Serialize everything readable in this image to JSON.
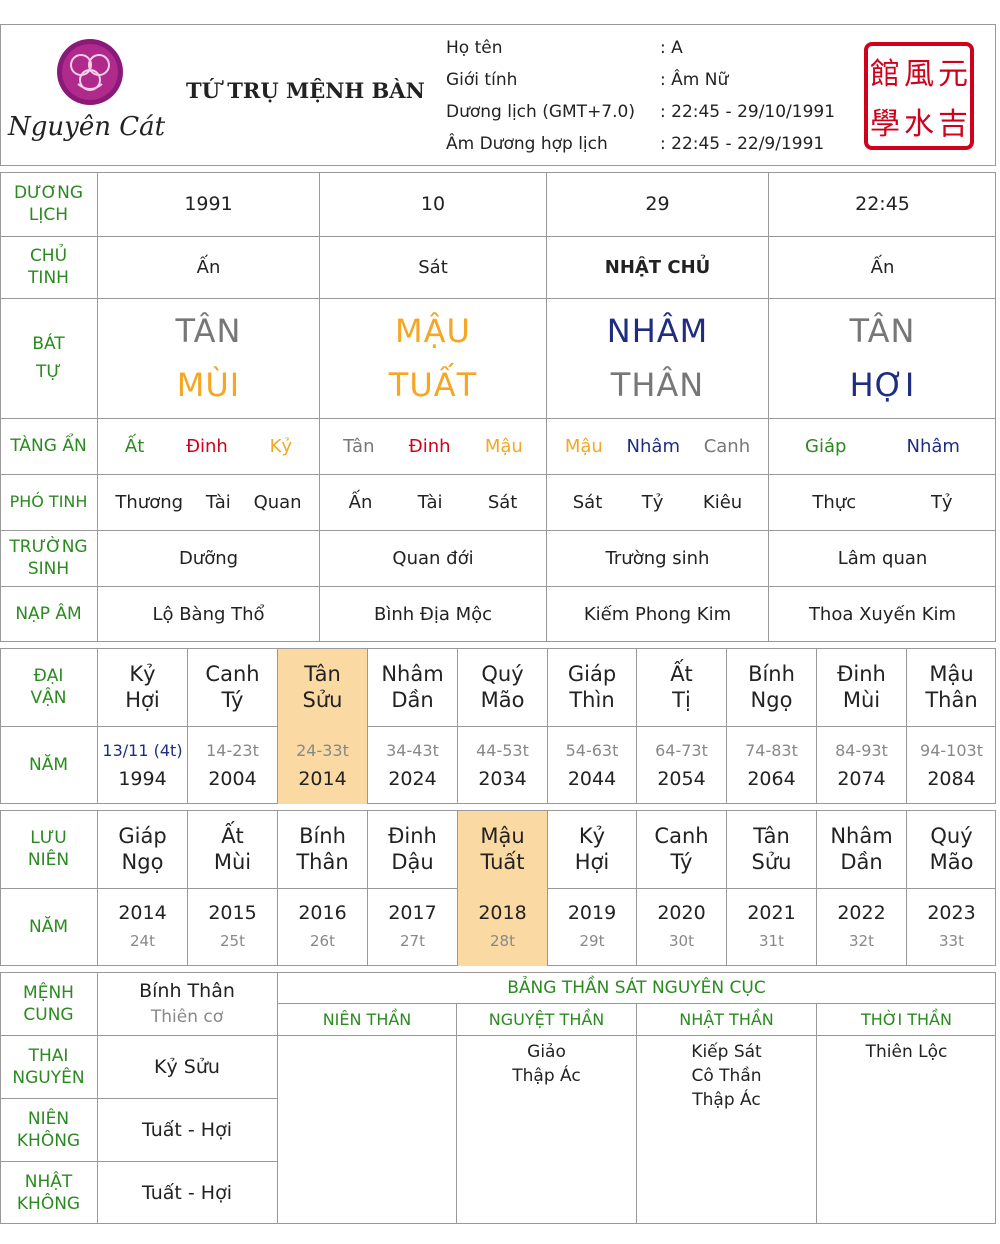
{
  "header": {
    "brand": "Nguyên Cát",
    "title": "TỨ TRỤ MỆNH BÀN",
    "info": [
      {
        "label": "Họ tên",
        "value": ": A"
      },
      {
        "label": "Giới tính",
        "value": ": Âm Nữ"
      },
      {
        "label": "Dương lịch (GMT+7.0)",
        "value": ": 22:45 - 29/10/1991"
      },
      {
        "label": "Âm Dương hợp lịch",
        "value": ": 22:45 - 22/9/1991"
      }
    ],
    "seal": [
      "元",
      "吉",
      "風",
      "水",
      "學",
      "館"
    ]
  },
  "labels": {
    "duong_lich": [
      "DƯƠNG",
      "LỊCH"
    ],
    "chu_tinh": [
      "CHỦ",
      "TINH"
    ],
    "bat_tu": [
      "BÁT",
      "TỰ"
    ],
    "tang_an": "TÀNG ẨN",
    "pho_tinh": "PHÓ TINH",
    "truong_sinh": [
      "TRƯỜNG",
      "SINH"
    ],
    "nap_am": "NẠP ÂM",
    "dai_van": [
      "ĐẠI",
      "VẬN"
    ],
    "nam": "NĂM",
    "luu_nien": [
      "LƯU",
      "NIÊN"
    ],
    "menh_cung": [
      "MỆNH",
      "CUNG"
    ],
    "thai_nguyen": [
      "THAI",
      "NGUYÊN"
    ],
    "nien_khong": [
      "NIÊN",
      "KHÔNG"
    ],
    "nhat_khong": [
      "NHẬT",
      "KHÔNG"
    ]
  },
  "pillars": [
    {
      "duong_lich": "1991",
      "chu_tinh": "Ấn",
      "can": "TÂN",
      "can_color": "#777777",
      "chi": "MÙI",
      "chi_color": "#f5a623",
      "tang_an": [
        {
          "text": "Ất",
          "color": "#2a8a1f"
        },
        {
          "text": "Đinh",
          "color": "#d0021b"
        },
        {
          "text": "Kỷ",
          "color": "#f5a623"
        }
      ],
      "pho_tinh": [
        "Thương",
        "Tài",
        "Quan"
      ],
      "truong_sinh": "Dưỡng",
      "nap_am": "Lộ Bàng Thổ"
    },
    {
      "duong_lich": "10",
      "chu_tinh": "Sát",
      "can": "MẬU",
      "can_color": "#f5a623",
      "chi": "TUẤT",
      "chi_color": "#f5a623",
      "tang_an": [
        {
          "text": "Tân",
          "color": "#777777"
        },
        {
          "text": "Đinh",
          "color": "#d0021b"
        },
        {
          "text": "Mậu",
          "color": "#f5a623"
        }
      ],
      "pho_tinh": [
        "Ấn",
        "Tài",
        "Sát"
      ],
      "truong_sinh": "Quan đới",
      "nap_am": "Bình Địa Mộc"
    },
    {
      "duong_lich": "29",
      "chu_tinh": "NHẬT CHỦ",
      "can": "NHÂM",
      "can_color": "#1f2d80",
      "chi": "THÂN",
      "chi_color": "#777777",
      "tang_an": [
        {
          "text": "Mậu",
          "color": "#f5a623"
        },
        {
          "text": "Nhâm",
          "color": "#1f2d80"
        },
        {
          "text": "Canh",
          "color": "#777777"
        }
      ],
      "pho_tinh": [
        "Sát",
        "Tỷ",
        "Kiêu"
      ],
      "truong_sinh": "Trường sinh",
      "nap_am": "Kiếm Phong Kim"
    },
    {
      "duong_lich": "22:45",
      "chu_tinh": "Ấn",
      "can": "TÂN",
      "can_color": "#777777",
      "chi": "HỢI",
      "chi_color": "#1f2d80",
      "tang_an": [
        {
          "text": "Giáp",
          "color": "#2a8a1f"
        },
        {
          "text": "Nhâm",
          "color": "#1f2d80"
        }
      ],
      "pho_tinh": [
        "Thực",
        "Tỷ"
      ],
      "truong_sinh": "Lâm quan",
      "nap_am": "Thoa Xuyến Kim"
    }
  ],
  "dai_van": [
    {
      "can": "Kỷ",
      "chi": "Hợi",
      "age": "13/11 (4t)",
      "year": "1994",
      "age_color": "#1f2d80",
      "highlight": false
    },
    {
      "can": "Canh",
      "chi": "Tý",
      "age": "14-23t",
      "year": "2004",
      "highlight": false
    },
    {
      "can": "Tân",
      "chi": "Sửu",
      "age": "24-33t",
      "year": "2014",
      "highlight": true
    },
    {
      "can": "Nhâm",
      "chi": "Dần",
      "age": "34-43t",
      "year": "2024",
      "highlight": false
    },
    {
      "can": "Quý",
      "chi": "Mão",
      "age": "44-53t",
      "year": "2034",
      "highlight": false
    },
    {
      "can": "Giáp",
      "chi": "Thìn",
      "age": "54-63t",
      "year": "2044",
      "highlight": false
    },
    {
      "can": "Ất",
      "chi": "Tị",
      "age": "64-73t",
      "year": "2054",
      "highlight": false
    },
    {
      "can": "Bính",
      "chi": "Ngọ",
      "age": "74-83t",
      "year": "2064",
      "highlight": false
    },
    {
      "can": "Đinh",
      "chi": "Mùi",
      "age": "84-93t",
      "year": "2074",
      "highlight": false
    },
    {
      "can": "Mậu",
      "chi": "Thân",
      "age": "94-103t",
      "year": "2084",
      "highlight": false
    }
  ],
  "luu_nien": [
    {
      "can": "Giáp",
      "chi": "Ngọ",
      "year": "2014",
      "age": "24t",
      "highlight": false
    },
    {
      "can": "Ất",
      "chi": "Mùi",
      "year": "2015",
      "age": "25t",
      "highlight": false
    },
    {
      "can": "Bính",
      "chi": "Thân",
      "year": "2016",
      "age": "26t",
      "highlight": false
    },
    {
      "can": "Đinh",
      "chi": "Dậu",
      "year": "2017",
      "age": "27t",
      "highlight": false
    },
    {
      "can": "Mậu",
      "chi": "Tuất",
      "year": "2018",
      "age": "28t",
      "highlight": true
    },
    {
      "can": "Kỷ",
      "chi": "Hợi",
      "year": "2019",
      "age": "29t",
      "highlight": false
    },
    {
      "can": "Canh",
      "chi": "Tý",
      "year": "2020",
      "age": "30t",
      "highlight": false
    },
    {
      "can": "Tân",
      "chi": "Sửu",
      "year": "2021",
      "age": "31t",
      "highlight": false
    },
    {
      "can": "Nhâm",
      "chi": "Dần",
      "year": "2022",
      "age": "32t",
      "highlight": false
    },
    {
      "can": "Quý",
      "chi": "Mão",
      "year": "2023",
      "age": "33t",
      "highlight": false
    }
  ],
  "bottom": {
    "menh_cung": "Bính Thân",
    "menh_cung_sub": "Thiên cơ",
    "thai_nguyen": "Kỷ Sửu",
    "nien_khong": "Tuất - Hợi",
    "nhat_khong": "Tuất - Hợi",
    "than_sat_title": "BẢNG THẦN SÁT NGUYÊN CỤC",
    "columns": [
      {
        "header": "NIÊN THẦN",
        "items": []
      },
      {
        "header": "NGUYỆT THẦN",
        "items": [
          "Giảo",
          "Thập Ác"
        ]
      },
      {
        "header": "NHẬT THẦN",
        "items": [
          "Kiếp Sát",
          "Cô Thần",
          "Thập Ác"
        ]
      },
      {
        "header": "THỜI THẦN",
        "items": [
          "Thiên Lộc"
        ]
      }
    ]
  }
}
